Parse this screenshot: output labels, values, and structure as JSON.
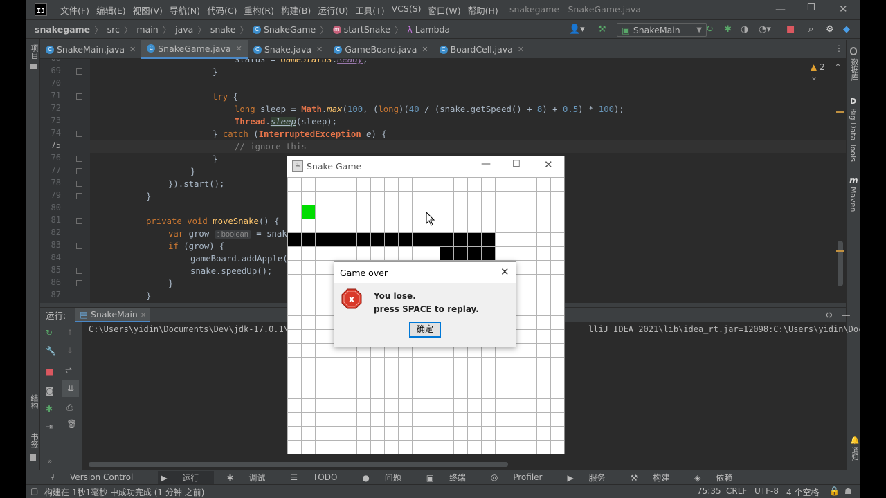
{
  "ide": {
    "menu": [
      "文件(F)",
      "编辑(E)",
      "视图(V)",
      "导航(N)",
      "代码(C)",
      "重构(R)",
      "构建(B)",
      "运行(U)",
      "工具(T)",
      "VCS(S)",
      "窗口(W)",
      "帮助(H)"
    ],
    "window_title": "snakegame - SnakeGame.java",
    "breadcrumb": {
      "project": "snakegame",
      "p1": "src",
      "p2": "main",
      "p3": "java",
      "p4": "snake",
      "cls": "SnakeGame",
      "method": "startSnake",
      "lambda": "Lambda"
    },
    "run_config": "SnakeMain",
    "tabs": [
      "SnakeMain.java",
      "SnakeGame.java",
      "Snake.java",
      "GameBoard.java",
      "BoardCell.java"
    ],
    "active_tab": 1,
    "warnings": "2",
    "left_strip": {
      "project": "项目",
      "structure": "结构",
      "bookmarks": "书签"
    },
    "right_strip": {
      "db": "数据库",
      "bigdata": "Big Data Tools",
      "maven": "Maven"
    }
  },
  "code": {
    "line_numbers": [
      "68",
      "69",
      "70",
      "71",
      "72",
      "73",
      "74",
      "75",
      "76",
      "77",
      "78",
      "79",
      "80",
      "81",
      "82",
      "83",
      "84",
      "85",
      "86",
      "87",
      "88"
    ],
    "current_line": "75"
  },
  "run": {
    "label": "运行:",
    "config": "SnakeMain",
    "output_left": "C:\\Users\\yidin\\Documents\\Dev\\jdk-17.0.1\\b",
    "output_right": "lliJ IDEA 2021\\lib\\idea_rt.jar=12098:C:\\Users\\yidin\\Docume"
  },
  "bottom_tabs": [
    "Version Control",
    "运行",
    "调试",
    "TODO",
    "问题",
    "终端",
    "Profiler",
    "服务",
    "构建",
    "依赖"
  ],
  "status": {
    "message": "构建在 1秒1毫秒 中成功完成 (1 分钟 之前)",
    "position": "75:35",
    "line_sep": "CRLF",
    "encoding": "UTF-8",
    "indent": "4 个空格"
  },
  "game": {
    "title": "Snake Game",
    "apple_color": "#00dd00",
    "snake_color": "#000000",
    "grid_line_color": "#b4b4b4"
  },
  "dialog": {
    "title": "Game over",
    "line1": "You lose.",
    "line2": "press SPACE to replay.",
    "ok": "确定",
    "icon": "error-icon"
  }
}
